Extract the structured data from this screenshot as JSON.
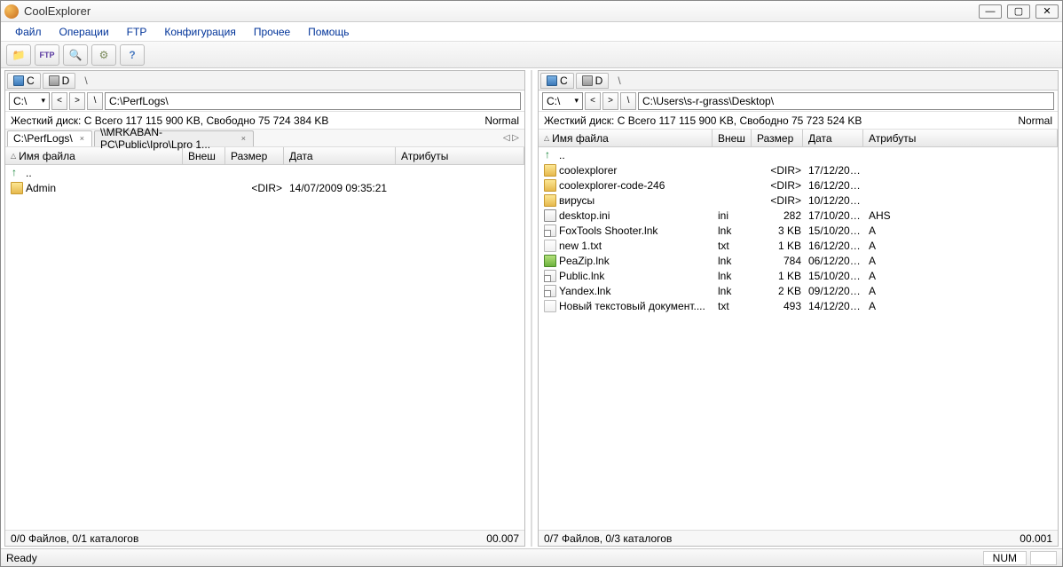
{
  "window": {
    "title": "CoolExplorer"
  },
  "menu": {
    "file": "Файл",
    "operations": "Операции",
    "ftp": "FTP",
    "config": "Конфигурация",
    "other": "Прочее",
    "help": "Помощь"
  },
  "drives": {
    "c": "C",
    "d": "D"
  },
  "left": {
    "drive_combo": "C:\\",
    "path": "C:\\PerfLogs\\",
    "info": "Жесткий диск: C          Всего 117 115 900 KB, Свободно 75 724 384 KB",
    "mode": "Normal",
    "tabs": [
      {
        "label": "C:\\PerfLogs\\",
        "active": true
      },
      {
        "label": "\\\\MRKABAN-PC\\Public\\Ipro\\Lpro 1...",
        "active": false
      }
    ],
    "columns": {
      "name": "Имя файла",
      "ext": "Внеш",
      "size": "Размер",
      "date": "Дата",
      "attr": "Атрибуты"
    },
    "rows": [
      {
        "icon": "up",
        "name": "..",
        "ext": "",
        "size": "",
        "date": "",
        "attr": ""
      },
      {
        "icon": "folder",
        "name": "Admin",
        "ext": "",
        "size": "<DIR>",
        "date": "14/07/2009 09:35:21",
        "attr": ""
      }
    ],
    "footer": "0/0 Файлов, 0/1 каталогов",
    "timer": "00.007"
  },
  "right": {
    "drive_combo": "C:\\",
    "path": "C:\\Users\\s-r-grass\\Desktop\\",
    "info": "Жесткий диск: C          Всего 117 115 900 KB, Свободно 75 723 524 KB",
    "mode": "Normal",
    "columns": {
      "name": "Имя файла",
      "ext": "Внеш",
      "size": "Размер",
      "date": "Дата",
      "attr": "Атрибуты"
    },
    "rows": [
      {
        "icon": "up",
        "name": "..",
        "ext": "",
        "size": "",
        "date": "",
        "attr": ""
      },
      {
        "icon": "folder",
        "name": "coolexplorer",
        "ext": "",
        "size": "<DIR>",
        "date": "17/12/201...",
        "attr": ""
      },
      {
        "icon": "folder",
        "name": "coolexplorer-code-246",
        "ext": "",
        "size": "<DIR>",
        "date": "16/12/201...",
        "attr": ""
      },
      {
        "icon": "folder",
        "name": "вирусы",
        "ext": "",
        "size": "<DIR>",
        "date": "10/12/201...",
        "attr": ""
      },
      {
        "icon": "ini",
        "name": "desktop.ini",
        "ext": "ini",
        "size": "282",
        "date": "17/10/201...",
        "attr": "AHS"
      },
      {
        "icon": "lnk",
        "name": "FoxTools Shooter.lnk",
        "ext": "lnk",
        "size": "3 KB",
        "date": "15/10/201...",
        "attr": "A"
      },
      {
        "icon": "txt",
        "name": "new 1.txt",
        "ext": "txt",
        "size": "1 KB",
        "date": "16/12/201...",
        "attr": "A"
      },
      {
        "icon": "app",
        "name": "PeaZip.lnk",
        "ext": "lnk",
        "size": "784",
        "date": "06/12/201...",
        "attr": "A"
      },
      {
        "icon": "lnk",
        "name": "Public.lnk",
        "ext": "lnk",
        "size": "1 KB",
        "date": "15/10/201...",
        "attr": "A"
      },
      {
        "icon": "lnk",
        "name": "Yandex.lnk",
        "ext": "lnk",
        "size": "2 KB",
        "date": "09/12/201...",
        "attr": "A"
      },
      {
        "icon": "txt",
        "name": "Новый текстовый документ....",
        "ext": "txt",
        "size": "493",
        "date": "14/12/201...",
        "attr": "A"
      }
    ],
    "footer": "0/7 Файлов, 0/3 каталогов",
    "timer": "00.001"
  },
  "status": {
    "ready": "Ready",
    "num": "NUM"
  },
  "colwidths": {
    "name": 200,
    "ext": 48,
    "size": 66,
    "date": 126,
    "attr": 94
  },
  "colwidths_r": {
    "name": 196,
    "ext": 44,
    "size": 58,
    "date": 68,
    "attr": 90
  }
}
